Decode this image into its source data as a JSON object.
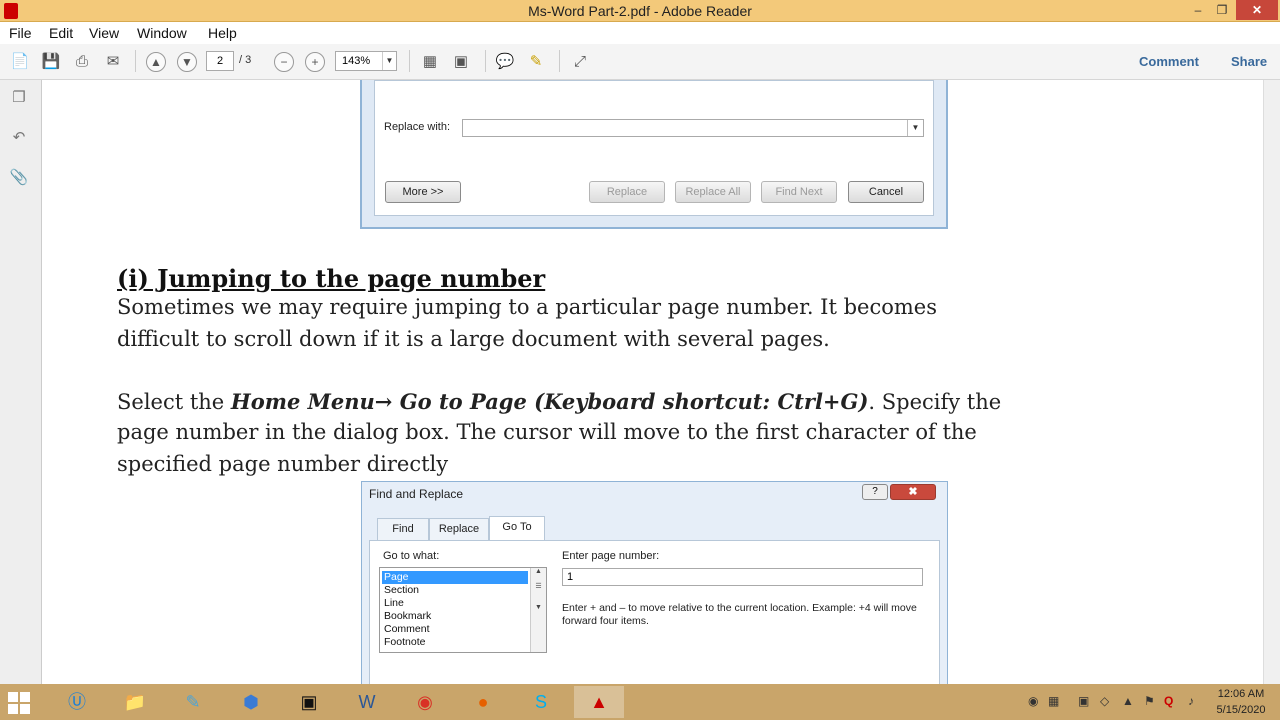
{
  "window": {
    "title": "Ms-Word Part-2.pdf - Adobe Reader"
  },
  "menu": [
    "File",
    "Edit",
    "View",
    "Window",
    "Help"
  ],
  "toolbar": {
    "page_current": "2",
    "page_total": "/ 3",
    "zoom": "143%",
    "comment_label": "Comment",
    "share_label": "Share"
  },
  "dialog1": {
    "replace_with_label": "Replace with:",
    "more_button": "More >>",
    "replace_button": "Replace",
    "replace_all_button": "Replace All",
    "find_next_button": "Find Next",
    "cancel_button": "Cancel"
  },
  "content": {
    "heading": "(i) Jumping to the page number",
    "para1_line1": "Sometimes we may require jumping to a particular page number. It becomes",
    "para1_line2": "difficult to scroll down if it is a large document with several pages.",
    "para2_prefix": "Select the ",
    "para2_bold": "Home Menu→ Go to Page (Keyboard shortcut: Ctrl+G)",
    "para2_suffix": ". Specify the",
    "para2_line2": "page number in the dialog box. The cursor will move to the first character of the",
    "para2_line3": "specified page number directly"
  },
  "dialog2": {
    "title": "Find and Replace",
    "help": "?",
    "close": "✖",
    "tabs": [
      "Find",
      "Replace",
      "Go To"
    ],
    "go_to_what_label": "Go to what:",
    "go_to_items": [
      "Page",
      "Section",
      "Line",
      "Bookmark",
      "Comment",
      "Footnote"
    ],
    "enter_page_label": "Enter page number:",
    "page_value": "1",
    "hint": "Enter + and – to move relative to the current location. Example: +4 will move forward four items."
  },
  "taskbar": {
    "time": "12:06 AM",
    "date": "5/15/2020"
  }
}
